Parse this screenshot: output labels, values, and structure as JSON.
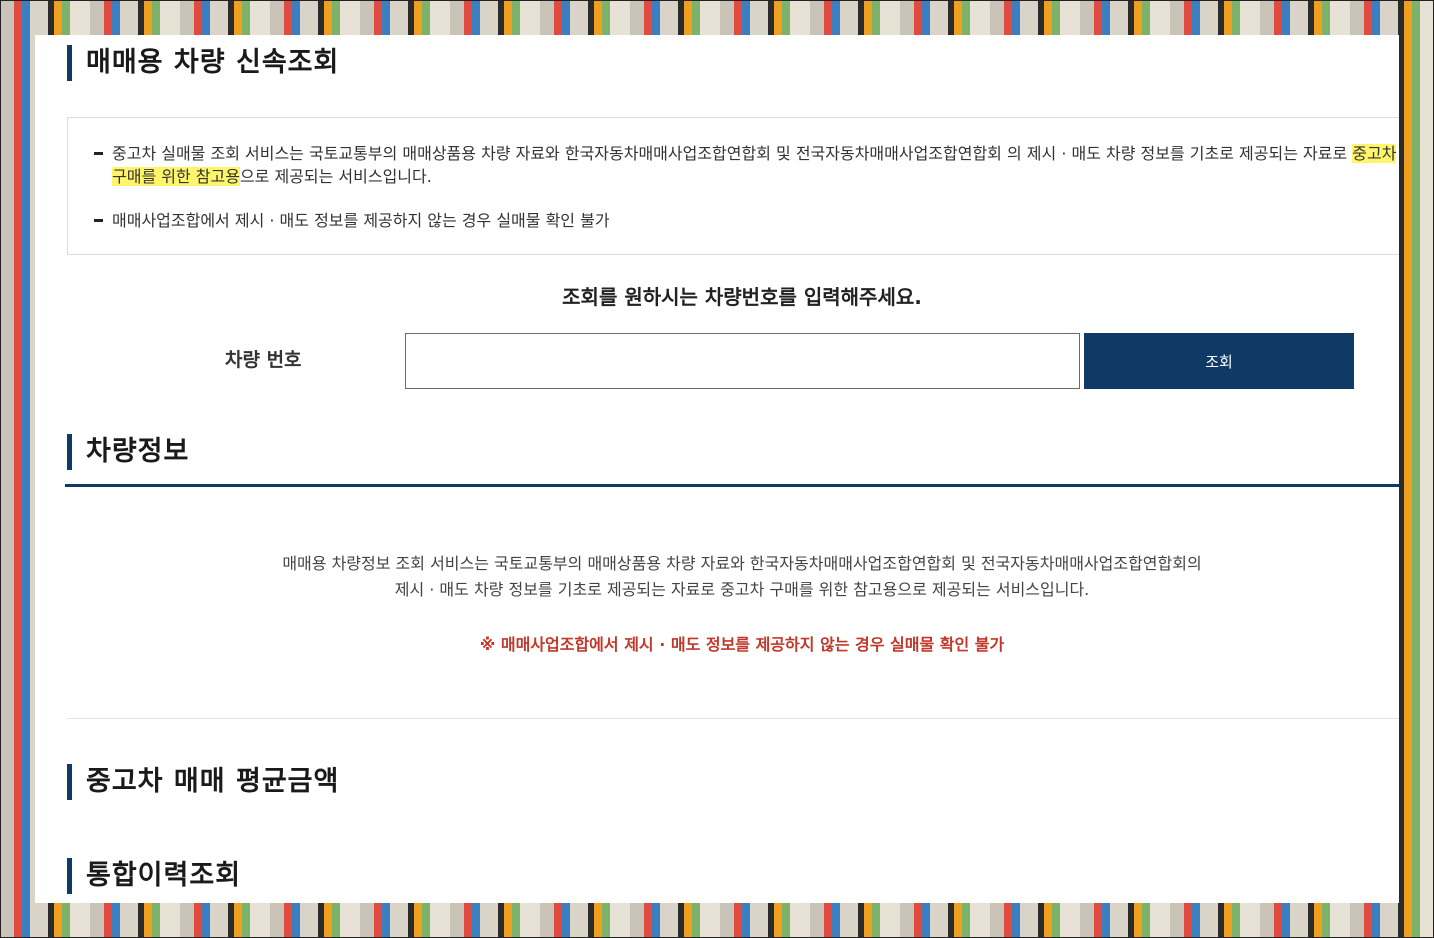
{
  "sections": {
    "lookup_title": "매매용 차량 신속조회",
    "vehicle_info_title": "차량정보",
    "avg_price_title": "중고차 매매 평균금액",
    "history_title": "통합이력조회"
  },
  "notice": {
    "item1_part1": "중고차 실매물 조회 서비스는 국토교통부의 매매상품용 차량 자료와 한국자동차매매사업조합연합회 및 전국자동차매매사업조합연합회 의 제시 · 매도 차량 정보를 기초로 제공되는 자료로 ",
    "item1_highlight": "중고차 구매를 위한 참고용",
    "item1_part2": "으로 제공되는 서비스입니다.",
    "item2": "매매사업조합에서 제시 · 매도 정보를 제공하지 않는 경우 실매물 확인 불가"
  },
  "search": {
    "prompt": "조회를 원하시는 차량번호를 입력해주세요.",
    "label": "차량 번호",
    "input_value": "",
    "button_label": "조회"
  },
  "info": {
    "line1": "매매용 차량정보 조회 서비스는 국토교통부의 매매상품용 차량 자료와 한국자동차매매사업조합연합회 및 전국자동차매매사업조합연합회의",
    "line2": "제시 · 매도 차량 정보를 기초로 제공되는 자료로 중고차 구매를 위한 참고용으로 제공되는 서비스입니다.",
    "warning": "※ 매매사업조합에서 제시 · 매도 정보를 제공하지 않는 경우 실매물 확인 불가"
  },
  "colors": {
    "accent": "#0f3a66",
    "highlight": "#fff56a",
    "warning": "#c0392b"
  }
}
